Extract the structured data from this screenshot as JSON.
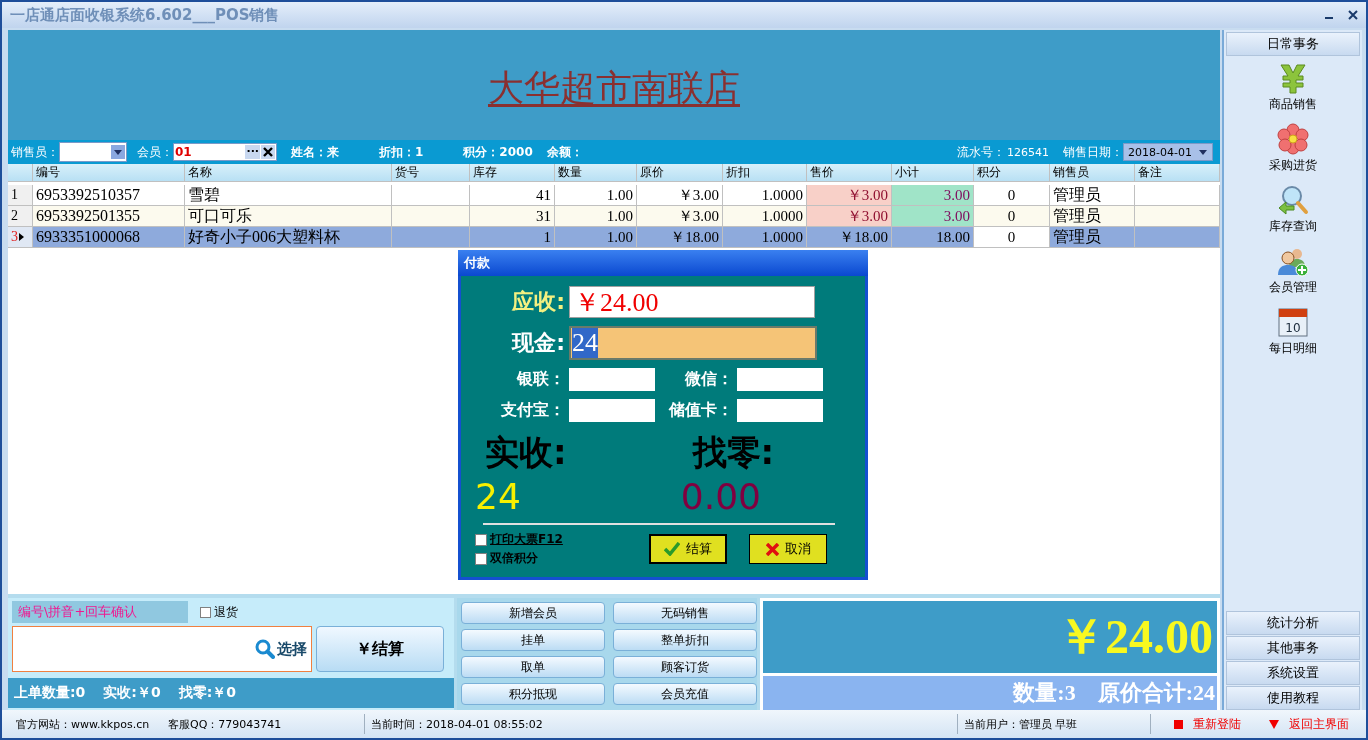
{
  "window": {
    "title": "一店通店面收银系统6.602___POS销售"
  },
  "store_name": "大华超市南联店",
  "toolbar": {
    "salesperson_label": "销售员：",
    "member_label": "会员：",
    "member_value": "01",
    "member_browse": "···",
    "name": "姓名：来",
    "discount": "折扣：1",
    "points": "积分：2000",
    "balance": "余额：",
    "serial_label": "流水号：",
    "serial_value": "126541",
    "date_label": "销售日期：",
    "date_value": "2018-04-01"
  },
  "table": {
    "columns": [
      "编号",
      "名称",
      "货号",
      "库存",
      "数量",
      "原价",
      "折扣",
      "售价",
      "小计",
      "积分",
      "销售员",
      "备注"
    ],
    "rows": [
      {
        "index": "1",
        "selected": false,
        "cells": [
          "6953392510357",
          "雪碧",
          "",
          "41",
          "1.00",
          "￥3.00",
          "1.0000",
          "￥3.00",
          "3.00",
          "0",
          "管理员",
          ""
        ]
      },
      {
        "index": "2",
        "selected": false,
        "cells": [
          "6953392501355",
          "可口可乐",
          "",
          "31",
          "1.00",
          "￥3.00",
          "1.0000",
          "￥3.00",
          "3.00",
          "0",
          "管理员",
          ""
        ]
      },
      {
        "index": "3",
        "selected": true,
        "cells": [
          "6933351000068",
          "好奇小子006大塑料杯",
          "",
          "1",
          "1.00",
          "￥18.00",
          "1.0000",
          "￥18.00",
          "18.00",
          "0",
          "管理员",
          ""
        ]
      }
    ]
  },
  "payment_dialog": {
    "title": "付款",
    "due_label": "应收:",
    "due_value": "￥24.00",
    "cash_label": "现金:",
    "cash_value": "24",
    "methods": [
      {
        "label": "银联："
      },
      {
        "label": "微信："
      },
      {
        "label": "支付宝："
      },
      {
        "label": "储值卡："
      }
    ],
    "received_label": "实收:",
    "change_label": "找零:",
    "received_value": "24",
    "change_value": "0.00",
    "options": [
      {
        "label": "打印大票F12",
        "checked": false
      },
      {
        "label": "双倍积分",
        "checked": false
      }
    ],
    "buttons": [
      {
        "label": "结算",
        "kind": "confirm"
      },
      {
        "label": "取消",
        "kind": "cancel"
      }
    ]
  },
  "entry": {
    "hint": "编号\\拼音+回车确认",
    "return_label": "退货",
    "return_checked": false,
    "select_button": "选择",
    "checkout_button": "￥结算",
    "last_qty": "上单数量:0",
    "last_received": "实收:￥0",
    "last_change": "找零:￥0"
  },
  "action_buttons": [
    "新增会员",
    "无码销售",
    "挂单",
    "整单折扣",
    "取单",
    "顾客订货",
    "积分抵现",
    "会员充值"
  ],
  "total": {
    "amount": "￥24.00",
    "quantity": "数量:3",
    "original_total": "原价合计:24"
  },
  "sidebar": {
    "header": "日常事务",
    "items": [
      {
        "label": "商品销售",
        "kind": "yen"
      },
      {
        "label": "采购进货",
        "kind": "flower"
      },
      {
        "label": "库存查询",
        "kind": "search"
      },
      {
        "label": "会员管理",
        "kind": "members"
      },
      {
        "label": "每日明细",
        "kind": "calendar",
        "icon_label": "10"
      }
    ],
    "bottom_buttons": [
      "统计分析",
      "其他事务",
      "系统设置",
      "使用教程"
    ]
  },
  "status_bar": {
    "website": "官方网站：www.kkpos.cn",
    "qq": "客服QQ：779043741",
    "time": "当前时间：2018-04-01 08:55:02",
    "user": "当前用户：管理员 早班",
    "relogin": "重新登陆",
    "home": "返回主界面"
  }
}
